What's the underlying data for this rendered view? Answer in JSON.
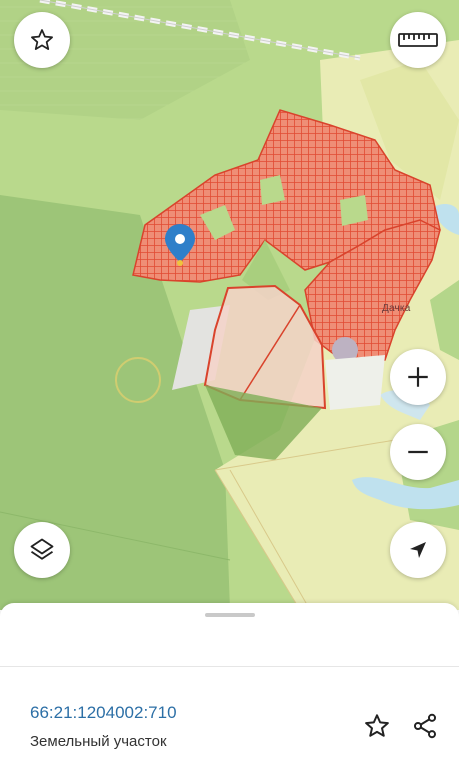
{
  "map": {
    "settlement_label": "Дачка",
    "colors": {
      "land": "#b9d98c",
      "forest": "#9dc578",
      "open_field": "#e9ecb5",
      "parcel_hatch": "#e4573f",
      "parcel_fill": "#ef8e76",
      "selected_parcel": "#f4d2c8",
      "water": "#bfe1ee",
      "pin": "#2f7fc9"
    }
  },
  "controls": {
    "favorite_icon": "star-outline-icon",
    "ruler_icon": "ruler-icon",
    "zoom_in_icon": "plus-icon",
    "zoom_out_icon": "minus-icon",
    "layers_icon": "layers-icon",
    "locate_icon": "navigation-arrow-icon"
  },
  "parcel": {
    "cadastral_number": "66:21:1204002:710",
    "type": "Земельный участок"
  },
  "sheet_actions": {
    "favorite_icon": "star-outline-icon",
    "share_icon": "share-icon"
  }
}
